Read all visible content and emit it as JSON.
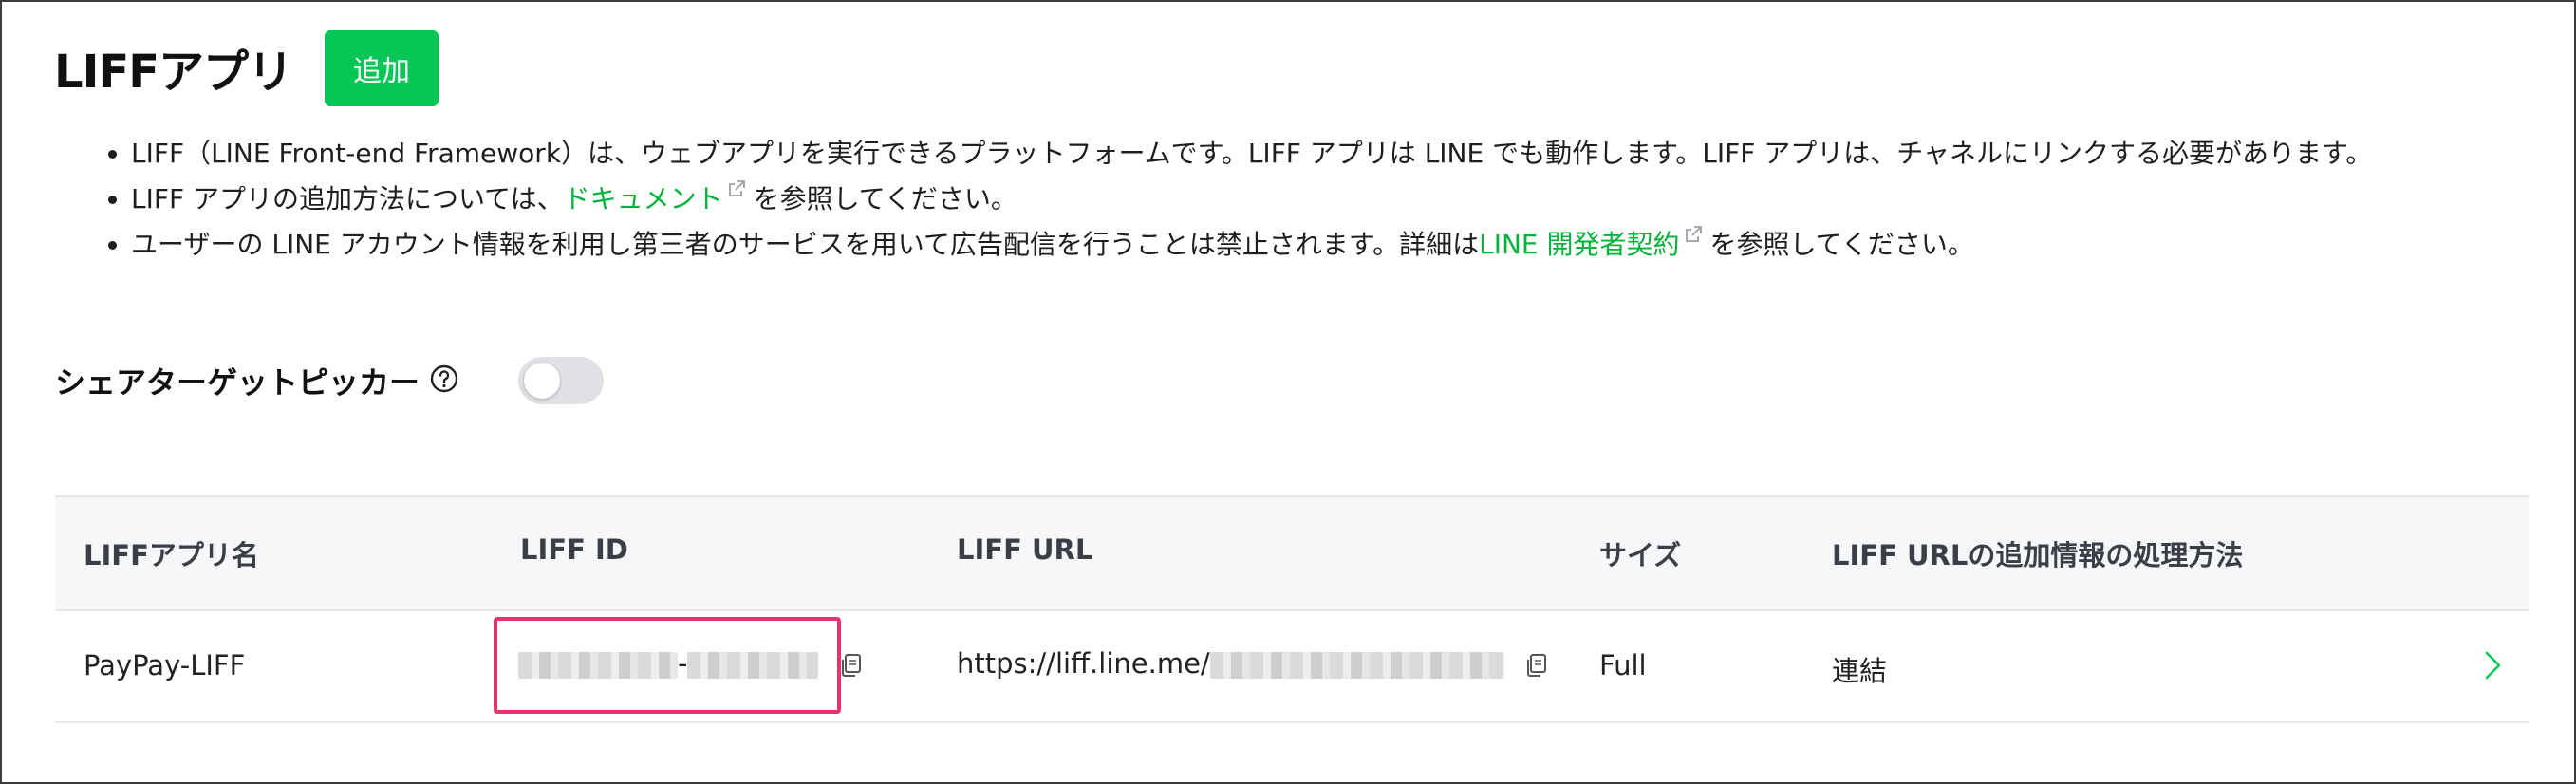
{
  "page": {
    "title": "LIFFアプリ",
    "add_button_label": "追加"
  },
  "notes": {
    "item1": "LIFF（LINE Front-end Framework）は、ウェブアプリを実行できるプラットフォームです。LIFF アプリは LINE でも動作します。LIFF アプリは、チャネルにリンクする必要があります。",
    "item2_prefix": "LIFF アプリの追加方法については、",
    "item2_link": "ドキュメント",
    "item2_suffix": "を参照してください。",
    "item3_prefix": "ユーザーの LINE アカウント情報を利用し第三者のサービスを用いて広告配信を行うことは禁止されます。詳細は",
    "item3_link": "LINE 開発者契約",
    "item3_suffix": "を参照してください。"
  },
  "share_target_picker": {
    "label": "シェアターゲットピッカー",
    "enabled": false
  },
  "table": {
    "headers": {
      "name": "LIFFアプリ名",
      "id": "LIFF ID",
      "url": "LIFF URL",
      "size": "サイズ",
      "mode": "LIFF URLの追加情報の処理方法"
    },
    "rows": [
      {
        "name": "PayPay-LIFF",
        "id_separator": "-",
        "url_prefix": "https://liff.line.me/",
        "size": "Full",
        "mode": "連結"
      }
    ]
  },
  "colors": {
    "brand_green": "#06c755",
    "link_green": "#06b33a",
    "highlight": "#e8336d"
  }
}
